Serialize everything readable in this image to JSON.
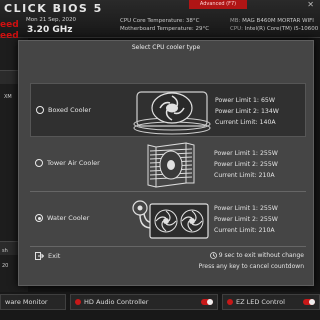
{
  "bios": {
    "logo": "CLICK BIOS 5",
    "advanced_label": "Advanced (F7)",
    "date": "Mon  21 Sep, 2020",
    "freq": "3.20 GHz",
    "speed_label_1": "eed",
    "speed_label_2": "eed",
    "cpu_temp": "CPU Core Temperature:  38°C",
    "mb_temp": "Motherboard Temperature: 29°C",
    "mb_key": "MB:",
    "mb_value": "MAG B460M MORTAR WIFI",
    "cpu_key": "CPU:",
    "cpu_value": "Intel(R) Core(TM) i5-10600",
    "left_items": [
      "XM",
      "sh",
      "20"
    ],
    "bottom": {
      "hw_monitor": "ware Monitor",
      "hd_audio": "HD Audio Controller",
      "ez_led": "EZ LED Control"
    },
    "colors": {
      "accent": "#c81818",
      "dialog_bg": "#454545",
      "selected_bg": "#303030"
    }
  },
  "dialog": {
    "title": "Select CPU cooler type",
    "options": [
      {
        "label": "Boxed Cooler",
        "icon": "boxed-cooler-fan-icon",
        "checked": false,
        "specs": [
          "Power Limit 1: 65W",
          "Power Limit 2: 134W",
          "Current Limit: 140A"
        ]
      },
      {
        "label": "Tower Air Cooler",
        "icon": "tower-air-cooler-icon",
        "checked": false,
        "specs": [
          "Power Limit 1: 255W",
          "Power Limit 2: 255W",
          "Current Limit: 210A"
        ]
      },
      {
        "label": "Water Cooler",
        "icon": "water-cooler-radiator-icon",
        "checked": true,
        "specs": [
          "Power Limit 1: 255W",
          "Power Limit 2: 255W",
          "Current Limit: 210A"
        ]
      }
    ],
    "exit_label": "Exit",
    "countdown_seconds": "9",
    "countdown_line1": " sec to exit without change",
    "countdown_line2": "Press any key to cancel countdown"
  }
}
